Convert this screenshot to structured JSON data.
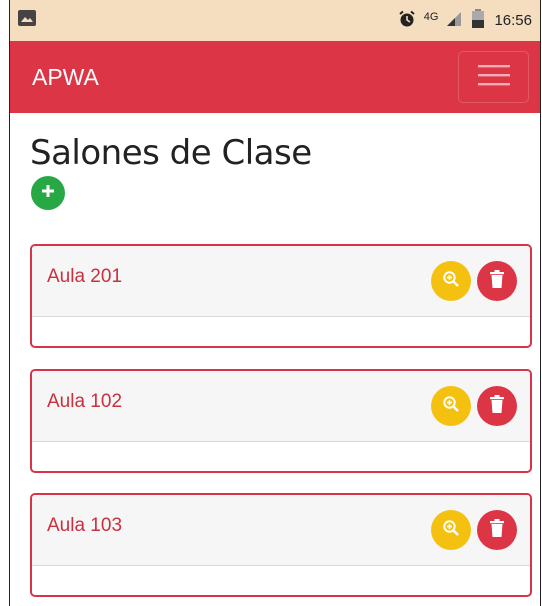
{
  "status_bar": {
    "network": "4G",
    "time": "16:56",
    "icons": [
      "image-icon",
      "alarm-icon",
      "signal-icon",
      "battery-icon"
    ]
  },
  "navbar": {
    "brand": "APWA",
    "menu_icon": "hamburger-icon",
    "color": "#dc3545"
  },
  "page": {
    "title": "Salones de Clase",
    "add_icon": "plus-icon"
  },
  "classrooms": [
    {
      "name": "Aula 201"
    },
    {
      "name": "Aula 102"
    },
    {
      "name": "Aula 103"
    }
  ],
  "colors": {
    "add": "#28a745",
    "view": "#f5c110",
    "delete": "#dc3545",
    "card_border": "#d63547"
  }
}
